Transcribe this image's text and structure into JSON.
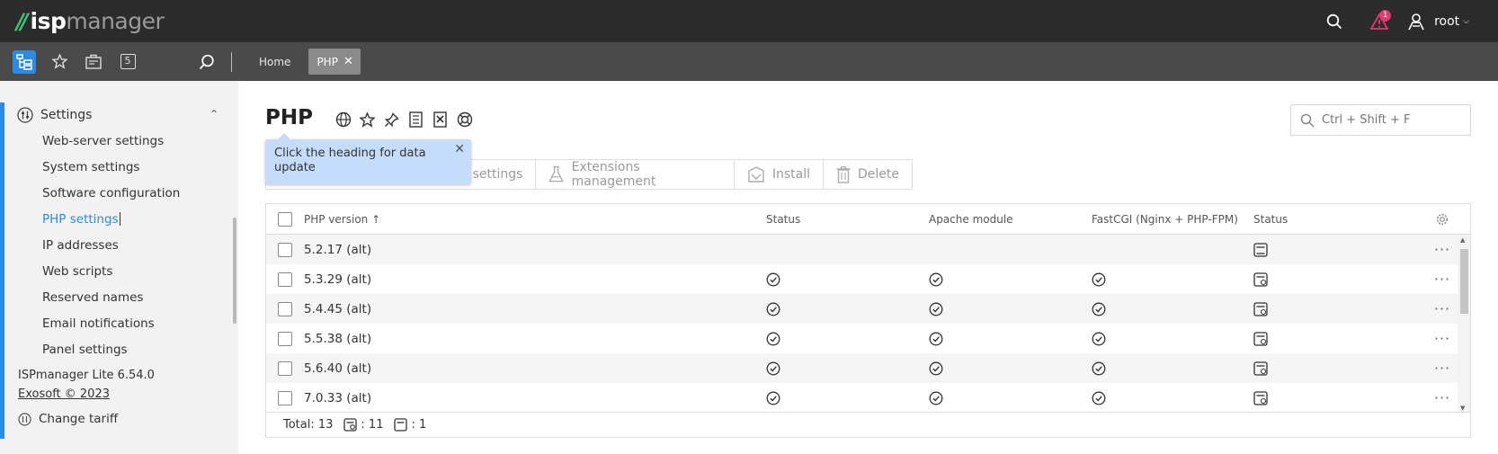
{
  "app": {
    "logo_isp": "isp",
    "logo_manager": "manager",
    "alert_count": "1",
    "user_name": "root"
  },
  "breadcrumbs": {
    "home": "Home",
    "active_tab": "PHP"
  },
  "sidebar": {
    "section": "Settings",
    "items": [
      {
        "label": "Web-server settings"
      },
      {
        "label": "System settings"
      },
      {
        "label": "Software configuration"
      },
      {
        "label": "PHP settings",
        "active": true
      },
      {
        "label": "IP addresses"
      },
      {
        "label": "Web scripts"
      },
      {
        "label": "Reserved names"
      },
      {
        "label": "Email notifications"
      },
      {
        "label": "Panel settings"
      }
    ],
    "version": "ISPmanager Lite 6.54.0",
    "copyright": "Exosoft © 2023",
    "change_tariff": "Change tariff"
  },
  "main": {
    "title": "PHP",
    "search_placeholder": "Ctrl + Shift + F",
    "tooltip": "Click the heading for data update",
    "actions": [
      {
        "label": "ed settings",
        "icon": "none"
      },
      {
        "label": "Extensions management",
        "icon": "flask-icon"
      },
      {
        "label": "Install",
        "icon": "install-icon"
      },
      {
        "label": "Delete",
        "icon": "trash-icon"
      }
    ],
    "table": {
      "columns": {
        "version": "PHP version",
        "sort_arrow": "↑",
        "status": "Status",
        "apache": "Apache module",
        "fastcgi": "FastCGI (Nginx + PHP-FPM)",
        "status2": "Status"
      },
      "rows": [
        {
          "version": "5.2.17 (alt)",
          "status": false,
          "apache": false,
          "fastcgi": false,
          "status2": "plain"
        },
        {
          "version": "5.3.29 (alt)",
          "status": true,
          "apache": true,
          "fastcgi": true,
          "status2": "configured"
        },
        {
          "version": "5.4.45 (alt)",
          "status": true,
          "apache": true,
          "fastcgi": true,
          "status2": "configured"
        },
        {
          "version": "5.5.38 (alt)",
          "status": true,
          "apache": true,
          "fastcgi": true,
          "status2": "configured"
        },
        {
          "version": "5.6.40 (alt)",
          "status": true,
          "apache": true,
          "fastcgi": true,
          "status2": "configured"
        },
        {
          "version": "7.0.33 (alt)",
          "status": true,
          "apache": true,
          "fastcgi": true,
          "status2": "configured"
        }
      ],
      "footer": {
        "total": "Total: 13",
        "configured_count": ": 11",
        "plain_count": ": 1"
      }
    }
  },
  "colors": {
    "accent": "#2b8ae2",
    "topbar": "#2b2b2b",
    "toolbar": "#4a4a4a",
    "logo_green": "#3ec47a",
    "alert": "#e23a6e",
    "tooltip": "#c5dcfa"
  }
}
